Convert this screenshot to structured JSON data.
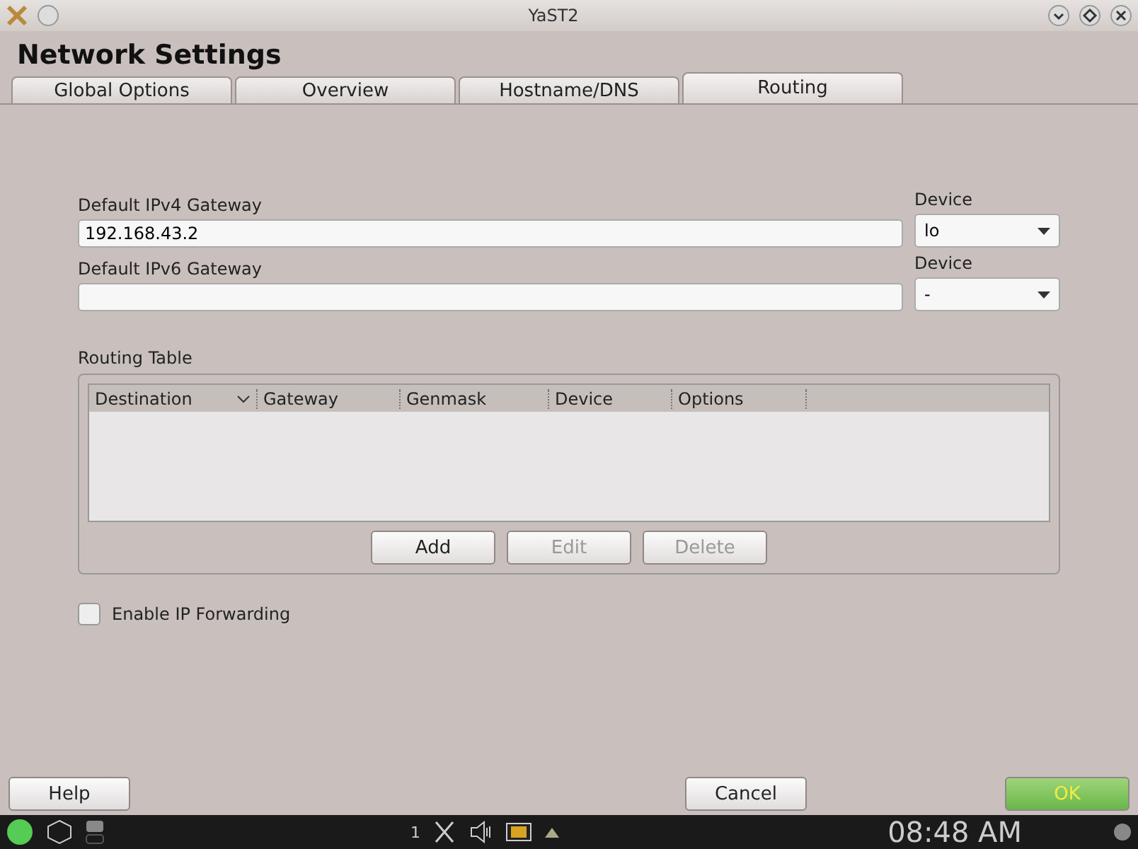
{
  "window": {
    "title": "YaST2"
  },
  "heading": "Network Settings",
  "tabs": [
    {
      "label": "Global Options",
      "selected": false
    },
    {
      "label": "Overview",
      "selected": false
    },
    {
      "label": "Hostname/DNS",
      "selected": false
    },
    {
      "label": "Routing",
      "selected": true
    }
  ],
  "gateways": [
    {
      "label": "Default IPv4 Gateway",
      "value": "192.168.43.2",
      "device_label": "Device",
      "device": "lo"
    },
    {
      "label": "Default IPv6 Gateway",
      "device_label": "Device",
      "device": "-"
    }
  ],
  "routing_table": {
    "title": "Routing Table",
    "columns": [
      {
        "label": "Destination",
        "sorted": true
      },
      {
        "label": "Gateway",
        "sorted": false
      },
      {
        "label": "Genmask",
        "sorted": false
      },
      {
        "label": "Device",
        "sorted": false
      },
      {
        "label": "Options",
        "sorted": false
      }
    ],
    "buttons": [
      {
        "label": "Add",
        "disabled": false
      },
      {
        "label": "Edit",
        "disabled": true
      },
      {
        "label": "Delete",
        "disabled": true
      }
    ]
  },
  "ip_forwarding": {
    "label": "Enable IP Forwarding",
    "checked": false
  },
  "footer": {
    "help": "Help",
    "cancel": "Cancel",
    "ok": "OK"
  },
  "taskbar": {
    "desktop": "1",
    "clock": "08:48 AM"
  }
}
